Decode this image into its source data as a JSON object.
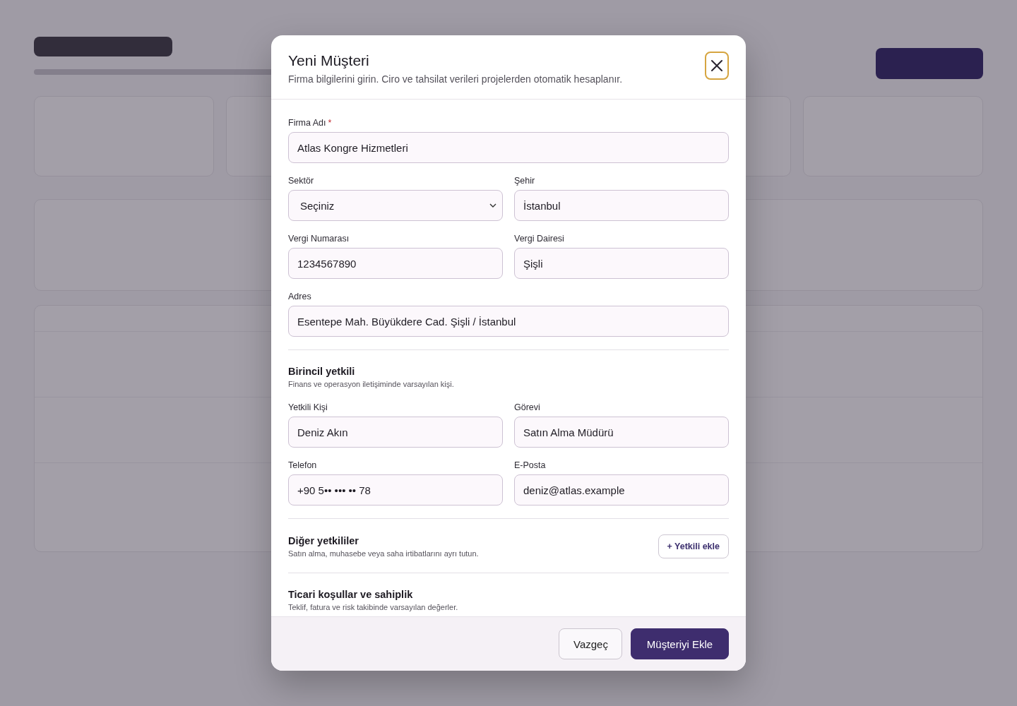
{
  "modal": {
    "title": "Yeni Müşteri",
    "subtitle": "Firma bilgilerini girin. Ciro ve tahsilat verileri projelerden otomatik hesaplanır.",
    "sections": [
      {
        "rows": [
          [
            {
              "label": "Firma Adı",
              "required_mark": "*",
              "kind": "text",
              "value": "Atlas Kongre Hizmetleri"
            }
          ],
          [
            {
              "label": "Sektör",
              "kind": "select",
              "value": "Seçiniz"
            },
            {
              "label": "Şehir",
              "kind": "text",
              "value": "İstanbul"
            }
          ],
          [
            {
              "label": "Vergi Numarası",
              "kind": "text",
              "value": "1234567890"
            },
            {
              "label": "Vergi Dairesi",
              "kind": "text",
              "value": "Şişli"
            }
          ],
          [
            {
              "label": "Adres",
              "kind": "text",
              "value": "Esentepe Mah. Büyükdere Cad. Şişli / İstanbul"
            }
          ]
        ]
      },
      {
        "title": "Birincil yetkili",
        "subtitle": "Finans ve operasyon iletişiminde varsayılan kişi.",
        "rows": [
          [
            {
              "label": "Yetkili Kişi",
              "kind": "text",
              "value": "Deniz Akın"
            },
            {
              "label": "Görevi",
              "kind": "text",
              "value": "Satın Alma Müdürü"
            }
          ],
          [
            {
              "label": "Telefon",
              "kind": "text",
              "value": "+90 5•• ••• •• 78"
            },
            {
              "label": "E-Posta",
              "kind": "text",
              "value": "deniz@atlas.example"
            }
          ]
        ]
      },
      {
        "title": "Diğer yetkililer",
        "subtitle": "Satın alma, muhasebe veya saha irtibatlarını ayrı tutun.",
        "action": "+ Yetkili ekle"
      },
      {
        "title": "Ticari koşullar ve sahiplik",
        "subtitle": "Teklif, fatura ve risk takibinde varsayılan değerler."
      }
    ],
    "buttons": [
      {
        "label": "Vazgeç",
        "kind": "secondary"
      },
      {
        "label": "Müşteriyi Ekle",
        "kind": "primary"
      }
    ]
  }
}
